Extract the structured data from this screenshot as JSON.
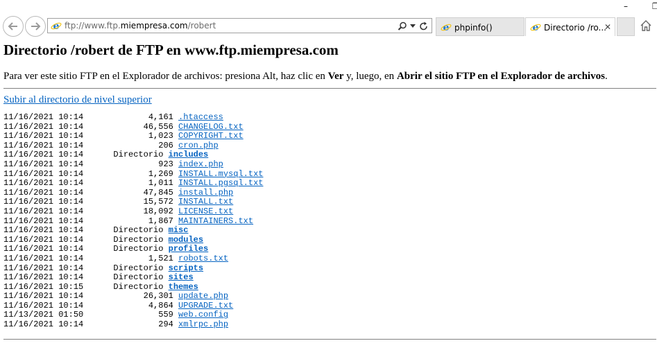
{
  "window": {
    "minimize": "–",
    "restore": "❐"
  },
  "address_bar": {
    "url_prefix": "ftp://www.ftp.",
    "url_domain": "miempresa.com",
    "url_suffix": "/robert"
  },
  "tabs": [
    {
      "label": "phpinfo()",
      "active": false
    },
    {
      "label": "Directorio /ro...",
      "active": true
    }
  ],
  "page": {
    "title": "Directorio /robert de FTP en www.ftp.miempresa.com",
    "info_part1": "Para ver este sitio FTP en el Explorador de archivos: presiona Alt, haz clic en ",
    "info_bold1": "Ver",
    "info_part2": " y, luego, en ",
    "info_bold2": "Abrir el sitio FTP en el Explorador de archivos",
    "info_part3": ".",
    "up_link": "Subir al directorio de nivel superior"
  },
  "listing": [
    {
      "date": "11/16/2021",
      "time": "10:14",
      "size": "4,161",
      "name": ".htaccess",
      "dir": false
    },
    {
      "date": "11/16/2021",
      "time": "10:14",
      "size": "46,556",
      "name": "CHANGELOG.txt",
      "dir": false
    },
    {
      "date": "11/16/2021",
      "time": "10:14",
      "size": "1,023",
      "name": "COPYRIGHT.txt",
      "dir": false
    },
    {
      "date": "11/16/2021",
      "time": "10:14",
      "size": "206",
      "name": "cron.php",
      "dir": false
    },
    {
      "date": "11/16/2021",
      "time": "10:14",
      "size": "Directorio",
      "name": "includes",
      "dir": true
    },
    {
      "date": "11/16/2021",
      "time": "10:14",
      "size": "923",
      "name": "index.php",
      "dir": false
    },
    {
      "date": "11/16/2021",
      "time": "10:14",
      "size": "1,269",
      "name": "INSTALL.mysql.txt",
      "dir": false
    },
    {
      "date": "11/16/2021",
      "time": "10:14",
      "size": "1,011",
      "name": "INSTALL.pgsql.txt",
      "dir": false
    },
    {
      "date": "11/16/2021",
      "time": "10:14",
      "size": "47,845",
      "name": "install.php",
      "dir": false
    },
    {
      "date": "11/16/2021",
      "time": "10:14",
      "size": "15,572",
      "name": "INSTALL.txt",
      "dir": false
    },
    {
      "date": "11/16/2021",
      "time": "10:14",
      "size": "18,092",
      "name": "LICENSE.txt",
      "dir": false
    },
    {
      "date": "11/16/2021",
      "time": "10:14",
      "size": "1,867",
      "name": "MAINTAINERS.txt",
      "dir": false
    },
    {
      "date": "11/16/2021",
      "time": "10:14",
      "size": "Directorio",
      "name": "misc",
      "dir": true
    },
    {
      "date": "11/16/2021",
      "time": "10:14",
      "size": "Directorio",
      "name": "modules",
      "dir": true
    },
    {
      "date": "11/16/2021",
      "time": "10:14",
      "size": "Directorio",
      "name": "profiles",
      "dir": true
    },
    {
      "date": "11/16/2021",
      "time": "10:14",
      "size": "1,521",
      "name": "robots.txt",
      "dir": false
    },
    {
      "date": "11/16/2021",
      "time": "10:14",
      "size": "Directorio",
      "name": "scripts",
      "dir": true
    },
    {
      "date": "11/16/2021",
      "time": "10:14",
      "size": "Directorio",
      "name": "sites",
      "dir": true
    },
    {
      "date": "11/16/2021",
      "time": "10:15",
      "size": "Directorio",
      "name": "themes",
      "dir": true
    },
    {
      "date": "11/16/2021",
      "time": "10:14",
      "size": "26,301",
      "name": "update.php",
      "dir": false
    },
    {
      "date": "11/16/2021",
      "time": "10:14",
      "size": "4,864",
      "name": "UPGRADE.txt",
      "dir": false
    },
    {
      "date": "11/13/2021",
      "time": "01:50",
      "size": "559",
      "name": "web.config",
      "dir": false
    },
    {
      "date": "11/16/2021",
      "time": "10:14",
      "size": "294",
      "name": "xmlrpc.php",
      "dir": false
    }
  ],
  "colors": {
    "link": "#0563c1",
    "ie_blue": "#1e78d2",
    "ie_ring": "#f0c419"
  }
}
